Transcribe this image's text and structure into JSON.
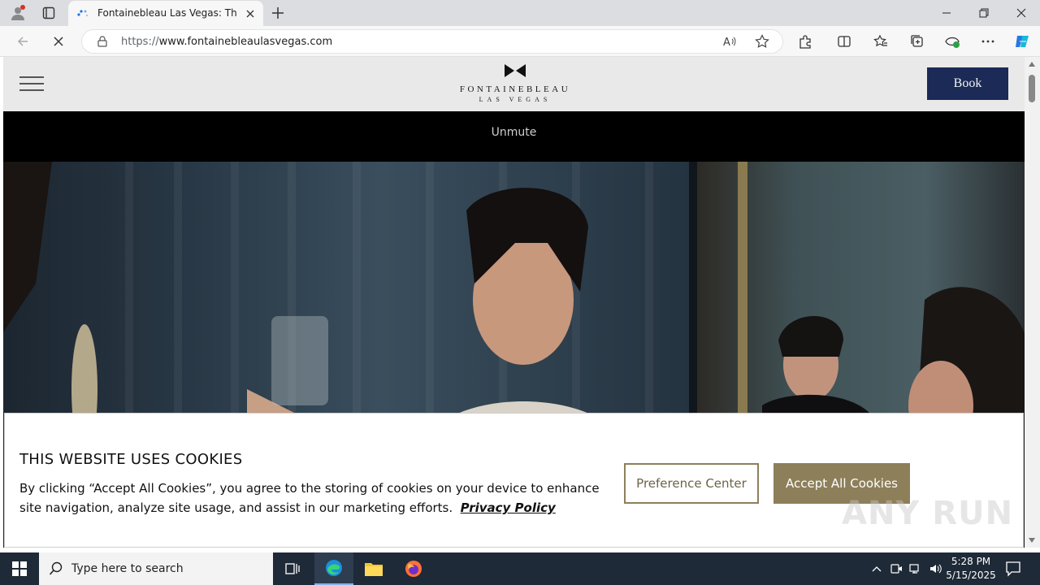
{
  "browser": {
    "tab_title": "Fontainebleau Las Vegas: The Be",
    "url_prefix": "https://",
    "url_host": "www.fontainebleaulasvegas.com"
  },
  "site": {
    "logo_name": "FONTAINEBLEAU",
    "logo_sub": "LAS VEGAS",
    "book_label": "Book",
    "unmute_label": "Unmute"
  },
  "cookie": {
    "title": "THIS WEBSITE USES COOKIES",
    "text": "By clicking “Accept All Cookies”, you agree to the storing of cookies on your device to enhance site navigation, analyze site usage, and assist in our marketing efforts.",
    "privacy_link": "Privacy Policy",
    "preference_label": "Preference Center",
    "accept_label": "Accept All Cookies"
  },
  "watermark": "ANY RUN",
  "taskbar": {
    "search_placeholder": "Type here to search",
    "time": "5:28 PM",
    "date": "5/15/2025"
  },
  "colors": {
    "book_button": "#1b2a56",
    "accent_gold": "#8d7f5a",
    "taskbar": "#1f2a38"
  }
}
